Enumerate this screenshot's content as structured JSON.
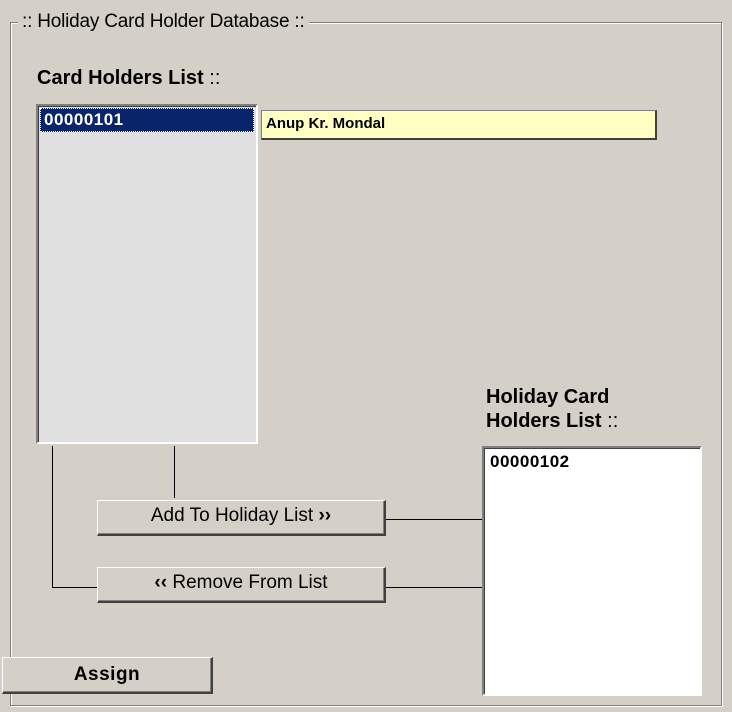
{
  "group": {
    "title": ":: Holiday Card Holder Database ::"
  },
  "card_holders": {
    "label": "Card Holders List",
    "label_suffix": " ::",
    "items": [
      {
        "id": "00000101",
        "selected": true
      }
    ],
    "selected_name": "Anup Kr. Mondal"
  },
  "holiday_list": {
    "label_line1": "Holiday Card",
    "label_line2": "Holders List",
    "label_suffix": " ::",
    "items": [
      {
        "id": "00000102",
        "selected": false
      }
    ]
  },
  "buttons": {
    "add": "Add To Holiday List",
    "add_arrows": "››",
    "remove_arrows": "‹‹",
    "remove": "Remove From List",
    "assign": "Assign"
  },
  "colors": {
    "window_bg": "#d4d0c8",
    "selection": "#0a246a",
    "name_field_bg": "#ffffc4"
  }
}
